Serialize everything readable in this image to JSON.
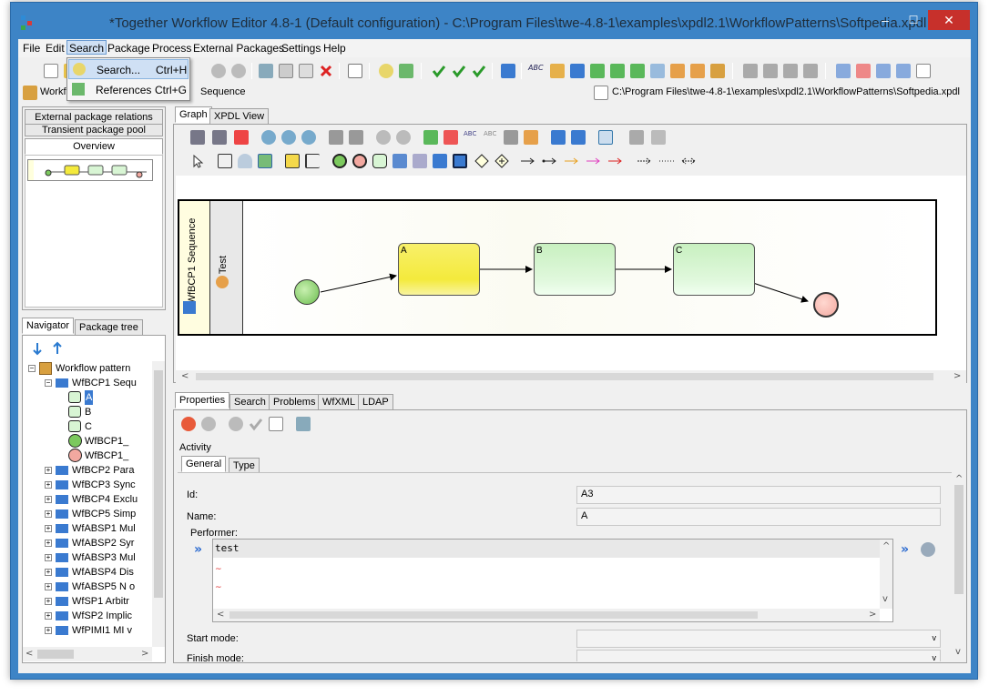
{
  "window": {
    "title": "*Together Workflow Editor 4.8-1 (Default configuration) - C:\\Program Files\\twe-4.8-1\\examples\\xpdl2.1\\WorkflowPatterns\\Softpedia.xpdl",
    "minimize": "–",
    "maximize": "☐",
    "close": "✕"
  },
  "menu": [
    "File",
    "Edit",
    "Search",
    "Package",
    "Process",
    "External Packages",
    "Settings",
    "Help"
  ],
  "search_menu": {
    "items": [
      {
        "label": "Search...",
        "shortcut": "Ctrl+H"
      },
      {
        "label": "References",
        "shortcut": "Ctrl+G"
      }
    ]
  },
  "pathbar": {
    "left_label": "Workfl",
    "left_label2": "Sequence",
    "path": "C:\\Program Files\\twe-4.8-1\\examples\\xpdl2.1\\WorkflowPatterns\\Softpedia.xpdl"
  },
  "left_top_tabs": [
    "External package relations",
    "Transient package pool",
    "Overview"
  ],
  "navigator_tabs": [
    "Navigator",
    "Package tree"
  ],
  "tree": [
    {
      "label": "Workflow pattern",
      "level": 0,
      "kind": "package"
    },
    {
      "label": "WfBCP1 Sequ",
      "level": 1,
      "kind": "process"
    },
    {
      "label": "A",
      "level": 2,
      "kind": "activity",
      "selected": true
    },
    {
      "label": "B",
      "level": 2,
      "kind": "activity"
    },
    {
      "label": "C",
      "level": 2,
      "kind": "activity"
    },
    {
      "label": "WfBCP1_",
      "level": 2,
      "kind": "start"
    },
    {
      "label": "WfBCP1_",
      "level": 2,
      "kind": "end"
    },
    {
      "label": "WfBCP2 Para",
      "level": 1,
      "kind": "process"
    },
    {
      "label": "WfBCP3 Sync",
      "level": 1,
      "kind": "process"
    },
    {
      "label": "WfBCP4 Exclu",
      "level": 1,
      "kind": "process"
    },
    {
      "label": "WfBCP5 Simp",
      "level": 1,
      "kind": "process"
    },
    {
      "label": "WfABSP1 Mul",
      "level": 1,
      "kind": "process"
    },
    {
      "label": "WfABSP2 Syr",
      "level": 1,
      "kind": "process"
    },
    {
      "label": "WfABSP3 Mul",
      "level": 1,
      "kind": "process"
    },
    {
      "label": "WfABSP4 Dis",
      "level": 1,
      "kind": "process"
    },
    {
      "label": "WfABSP5 N o",
      "level": 1,
      "kind": "process"
    },
    {
      "label": "WfSP1 Arbitr",
      "level": 1,
      "kind": "process"
    },
    {
      "label": "WfSP2 Implic",
      "level": 1,
      "kind": "process"
    },
    {
      "label": "WfPIMI1 MI v",
      "level": 1,
      "kind": "process"
    }
  ],
  "graph_tabs": [
    "Graph",
    "XPDL View"
  ],
  "diagram": {
    "pool": "WfBCP1 Sequence",
    "lane": "Test",
    "activities": [
      "A",
      "B",
      "C"
    ]
  },
  "bottom_tabs": [
    "Properties",
    "Search",
    "Problems",
    "WfXML",
    "LDAP"
  ],
  "properties": {
    "section": "Activity",
    "tabs": [
      "General",
      "Type"
    ],
    "id_label": "Id:",
    "id_value": "A3",
    "name_label": "Name:",
    "name_value": "A",
    "performer_label": "Performer:",
    "performer_value": "test",
    "start_mode_label": "Start mode:",
    "finish_mode_label": "Finish mode:"
  },
  "colors": {
    "title_bar": "#3d84c6",
    "activity_a": "#f4ea3c",
    "activity_green": "#d8f5d4",
    "start_event": "#7cc95e",
    "end_event": "#f2a8a0"
  }
}
